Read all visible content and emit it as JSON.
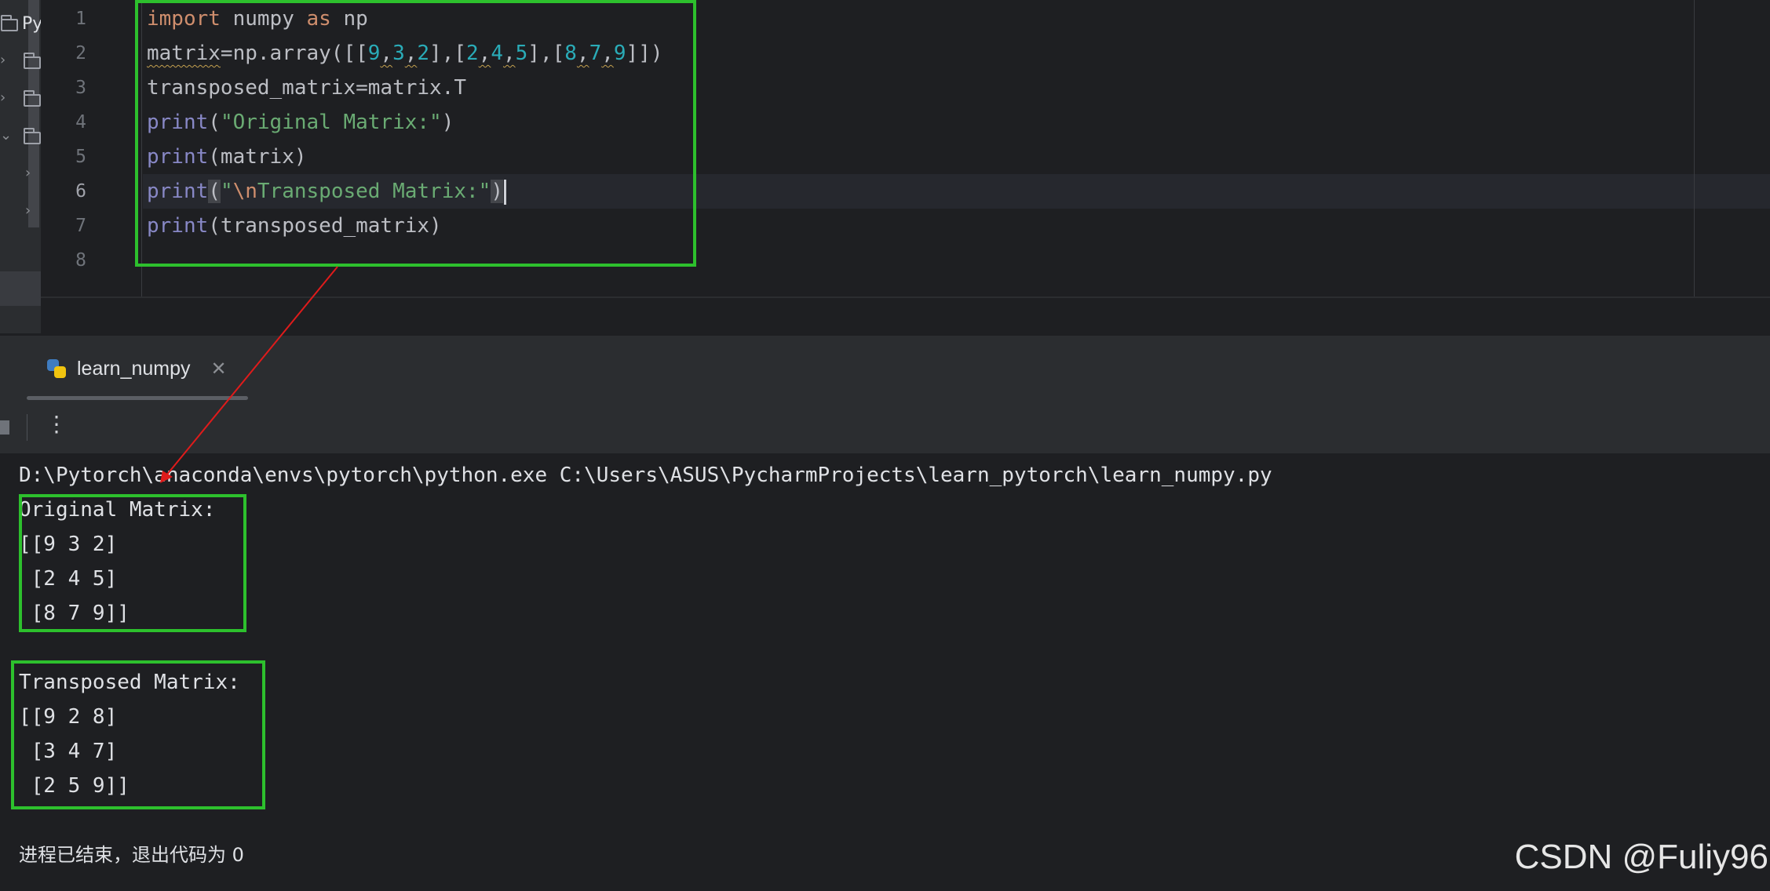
{
  "project_tree": {
    "root_label": "Py",
    "toggles": [
      "›",
      "›",
      "⌄",
      "›",
      "›"
    ]
  },
  "editor": {
    "line_numbers": [
      "1",
      "2",
      "3",
      "4",
      "5",
      "6",
      "7",
      "8"
    ],
    "active_line": "6",
    "lines": {
      "l1": {
        "kw1": "import",
        "t1": " numpy ",
        "kw2": "as",
        "t2": " np"
      },
      "l2": {
        "t1": "matrix",
        "t2": "=np.array([[",
        "n1": "9",
        "c1": ",",
        "n2": "3",
        "c2": ",",
        "n3": "2",
        "t3": "],[",
        "n4": "2",
        "c3": ",",
        "n5": "4",
        "c4": ",",
        "n6": "5",
        "t4": "],[",
        "n7": "8",
        "c5": ",",
        "n8": "7",
        "c6": ",",
        "n9": "9",
        "t5": "]])"
      },
      "l3": {
        "t1": "transposed_matrix=matrix.T"
      },
      "l4": {
        "fn": "print",
        "p1": "(",
        "s": "\"Original Matrix:\"",
        "p2": ")"
      },
      "l5": {
        "fn": "print",
        "t": "(matrix)"
      },
      "l6": {
        "fn": "print",
        "p1": "(",
        "s1": "\"",
        "e": "\\n",
        "s2": "Transposed Matrix:\"",
        "p2": ")"
      },
      "l7": {
        "fn": "print",
        "t": "(transposed_matrix)"
      }
    }
  },
  "run_panel": {
    "tab_label": "learn_numpy",
    "close_glyph": "✕",
    "more_glyph": "⋮"
  },
  "console": {
    "command": "D:\\Pytorch\\anaconda\\envs\\pytorch\\python.exe C:\\Users\\ASUS\\PycharmProjects\\learn_pytorch\\learn_numpy.py",
    "original_header": "Original Matrix:",
    "original_rows": [
      "[[9 3 2]",
      " [2 4 5]",
      " [8 7 9]]"
    ],
    "transposed_header": "Transposed Matrix:",
    "transposed_rows": [
      "[[9 2 8]",
      " [3 4 7]",
      " [2 5 9]]"
    ],
    "exit_message": "进程已结束，退出代码为 0"
  },
  "watermark": "CSDN @Fuliy96",
  "colors": {
    "annotation_box": "#2dc02d",
    "annotation_arrow": "#e01b1b",
    "keyword": "#cf8e6d",
    "builtin": "#8888c6",
    "string": "#6aab73",
    "number": "#2aacb8"
  }
}
